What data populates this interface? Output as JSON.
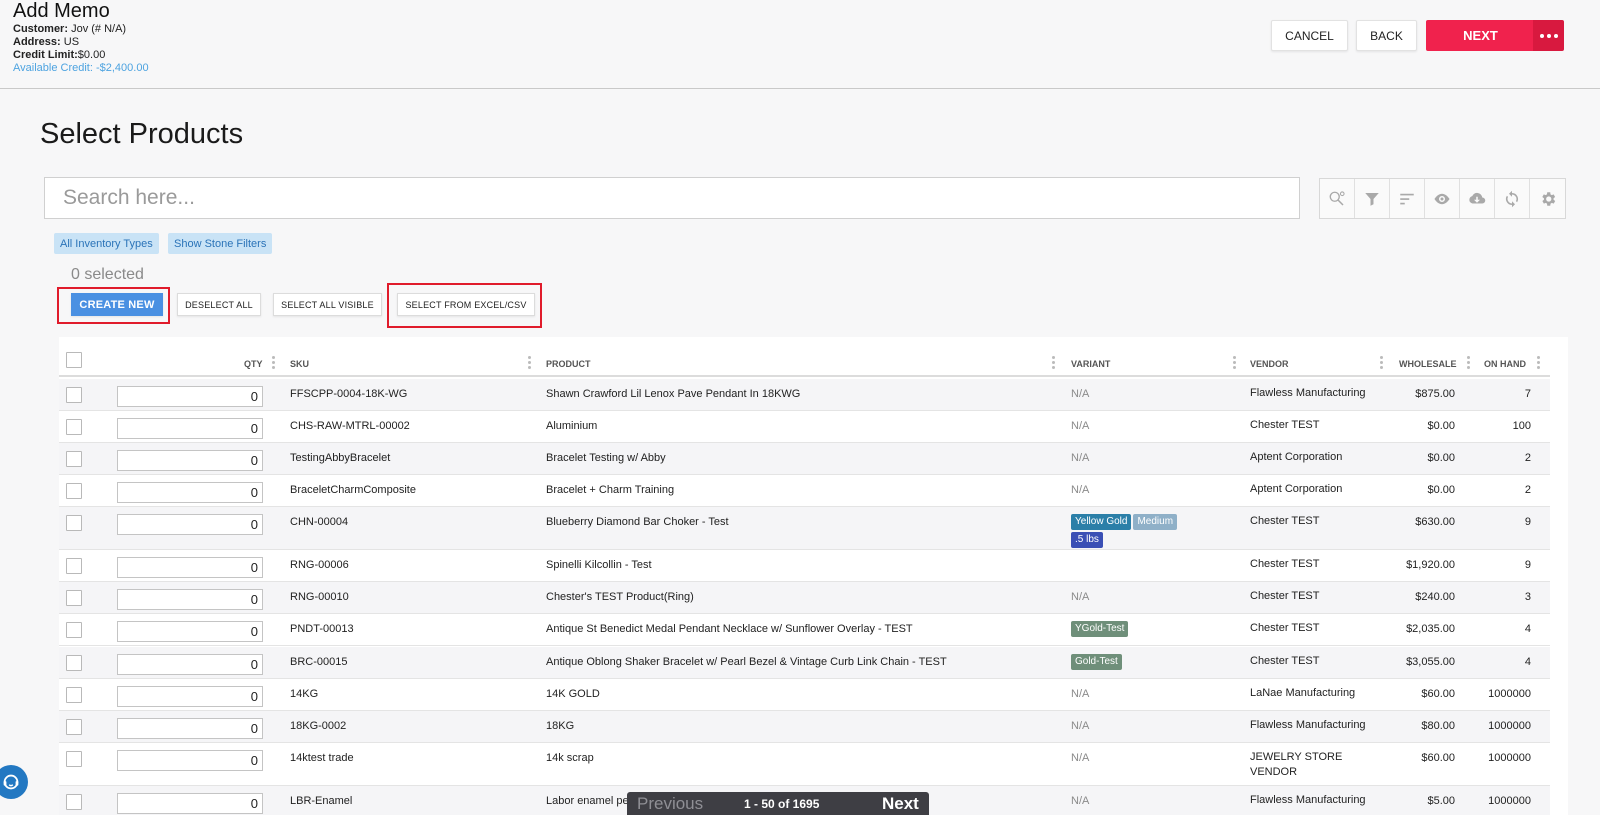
{
  "header": {
    "title": "Add Memo",
    "customer_label": "Customer:",
    "customer_value": "Jov (# N/A)",
    "address_label": "Address:",
    "address_value": "US",
    "credit_limit_label": "Credit Limit:",
    "credit_limit_value": "$0.00",
    "available_credit_label": "Available Credit:",
    "available_credit_value": "-$2,400.00",
    "cancel_label": "CANCEL",
    "back_label": "BACK",
    "next_label": "NEXT"
  },
  "page_title": "Select Products",
  "search": {
    "placeholder": "Search here..."
  },
  "toolbar_icons": [
    "search-settings-icon",
    "filter-icon",
    "sort-icon",
    "eye-icon",
    "cloud-download-icon",
    "refresh-icon",
    "gear-icon"
  ],
  "filters": {
    "inventory": "All Inventory Types",
    "stone": "Show Stone Filters"
  },
  "selection": {
    "count_text": "0 selected"
  },
  "actions": {
    "create_new": "CREATE NEW",
    "deselect_all": "DESELECT ALL",
    "select_all_visible": "SELECT ALL VISIBLE",
    "select_from_excel": "SELECT FROM EXCEL/CSV"
  },
  "table": {
    "columns": {
      "qty": "QTY",
      "sku": "SKU",
      "product": "PRODUCT",
      "variant": "VARIANT",
      "vendor": "VENDOR",
      "wholesale": "WHOLESALE",
      "on_hand": "ON HAND"
    },
    "rows": [
      {
        "qty": "0",
        "sku": "FFSCPP-0004-18K-WG",
        "product": "Shawn Crawford Lil Lenox Pave Pendant In 18KWG",
        "variant": "N/A",
        "vendor": "Flawless Manufacturing",
        "wholesale": "$875.00",
        "on_hand": "7"
      },
      {
        "qty": "0",
        "sku": "CHS-RAW-MTRL-00002",
        "product": "Aluminium",
        "variant": "N/A",
        "vendor": "Chester TEST",
        "wholesale": "$0.00",
        "on_hand": "100"
      },
      {
        "qty": "0",
        "sku": "TestingAbbyBracelet",
        "product": "Bracelet Testing w/ Abby",
        "variant": "N/A",
        "vendor": "Aptent Corporation",
        "wholesale": "$0.00",
        "on_hand": "2"
      },
      {
        "qty": "0",
        "sku": "BraceletCharmComposite",
        "product": "Bracelet + Charm Training",
        "variant": "N/A",
        "vendor": "Aptent Corporation",
        "wholesale": "$0.00",
        "on_hand": "2"
      },
      {
        "qty": "0",
        "sku": "CHN-00004",
        "product": "Blueberry Diamond Bar Choker - Test",
        "variant_chips": [
          {
            "text": "Yellow Gold",
            "color": "#2b7fa8"
          },
          {
            "text": "Medium",
            "color": "#8fb0c8"
          },
          {
            "text": ".5 lbs",
            "color": "#3a4fb5"
          }
        ],
        "vendor": "Chester TEST",
        "wholesale": "$630.00",
        "on_hand": "9"
      },
      {
        "qty": "0",
        "sku": "RNG-00006",
        "product": "Spinelli Kilcollin - Test",
        "variant": "",
        "vendor": "Chester TEST",
        "wholesale": "$1,920.00",
        "on_hand": "9"
      },
      {
        "qty": "0",
        "sku": "RNG-00010",
        "product": "Chester's TEST Product(Ring)",
        "variant": "N/A",
        "vendor": "Chester TEST",
        "wholesale": "$240.00",
        "on_hand": "3"
      },
      {
        "qty": "0",
        "sku": "PNDT-00013",
        "product": "Antique St Benedict Medal Pendant Necklace w/ Sunflower Overlay - TEST",
        "variant_chips": [
          {
            "text": "YGold-Test",
            "color": "#6f8f7a"
          }
        ],
        "vendor": "Chester TEST",
        "wholesale": "$2,035.00",
        "on_hand": "4"
      },
      {
        "qty": "0",
        "sku": "BRC-00015",
        "product": "Antique Oblong Shaker Bracelet w/ Pearl Bezel & Vintage Curb Link Chain - TEST",
        "variant_chips": [
          {
            "text": "Gold-Test",
            "color": "#6f8f7a"
          }
        ],
        "vendor": "Chester TEST",
        "wholesale": "$3,055.00",
        "on_hand": "4"
      },
      {
        "qty": "0",
        "sku": "14KG",
        "product": "14K GOLD",
        "variant": "N/A",
        "vendor": "LaNae Manufacturing",
        "wholesale": "$60.00",
        "on_hand": "1000000"
      },
      {
        "qty": "0",
        "sku": "18KG-0002",
        "product": "18KG",
        "variant": "N/A",
        "vendor": "Flawless Manufacturing",
        "wholesale": "$80.00",
        "on_hand": "1000000"
      },
      {
        "qty": "0",
        "sku": "14ktest trade",
        "product": "14k scrap",
        "variant": "N/A",
        "vendor": "JEWELRY STORE VENDOR",
        "wholesale": "$60.00",
        "on_hand": "1000000"
      },
      {
        "qty": "0",
        "sku": "LBR-Enamel",
        "product": "Labor enamel pe",
        "variant": "N/A",
        "vendor": "Flawless Manufacturing",
        "wholesale": "$5.00",
        "on_hand": "1000000"
      }
    ]
  },
  "pagination": {
    "previous": "Previous",
    "info": "1 - 50 of 1695",
    "next": "Next"
  }
}
